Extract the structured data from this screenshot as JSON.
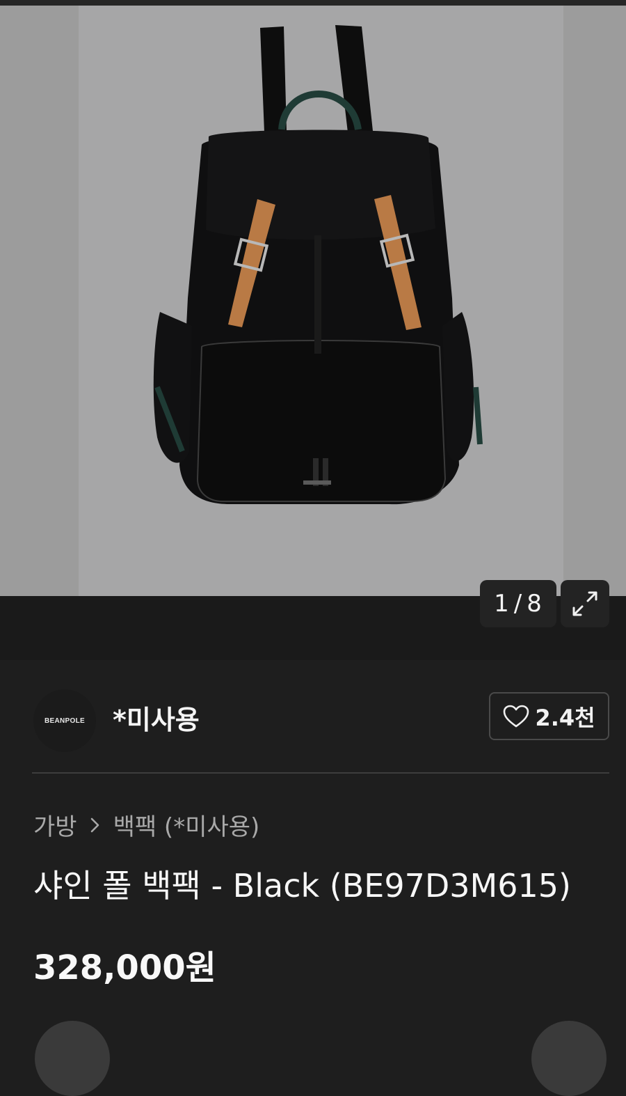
{
  "gallery": {
    "current": "1",
    "separator": "/",
    "total": "8",
    "expand_icon": "expand-arrows-icon"
  },
  "seller": {
    "logo_text": "BEANPOLE",
    "name": "*미사용"
  },
  "like": {
    "icon": "heart-outline-icon",
    "count": "2.4천"
  },
  "breadcrumb": {
    "category": "가방",
    "subcategory": "백팩 (*미사용)"
  },
  "product": {
    "title": "샤인 폴 백팩 - Black (BE97D3M615)",
    "price": "328,000원"
  },
  "colors": {
    "background": "#1e1e1e",
    "strap_tan": "#b97a45",
    "handle_teal": "#1f3b35"
  }
}
